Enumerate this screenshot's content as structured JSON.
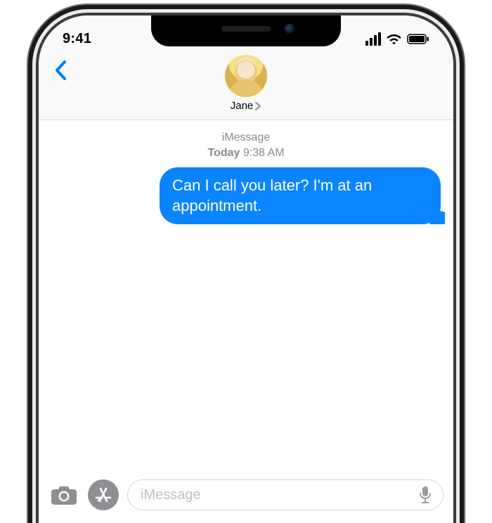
{
  "status": {
    "time": "9:41"
  },
  "header": {
    "contact_name": "Jane"
  },
  "thread": {
    "service_label": "iMessage",
    "timestamp_day": "Today",
    "timestamp_time": "9:38 AM",
    "messages": [
      {
        "direction": "sent",
        "text": "Can I call you later? I'm at an appointment."
      }
    ]
  },
  "compose": {
    "placeholder": "iMessage",
    "value": ""
  }
}
